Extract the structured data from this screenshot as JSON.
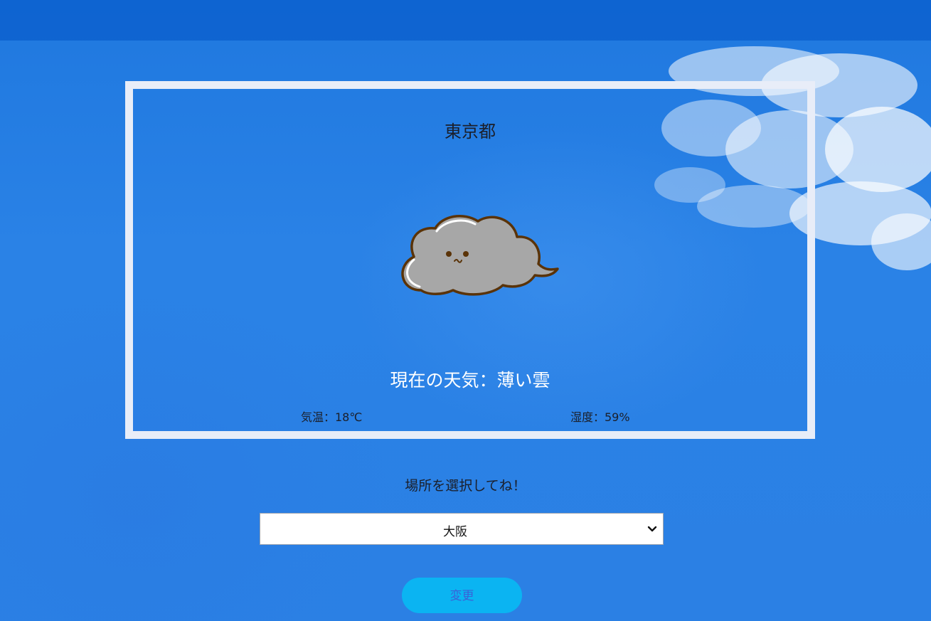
{
  "weather": {
    "city": "東京都",
    "description": "現在の天気：薄い雲",
    "temperature": "気温：18℃",
    "humidity": "湿度：59%",
    "icon": "cloud-character-icon"
  },
  "location_picker": {
    "label": "場所を選択してね！",
    "selected": "大阪",
    "button_label": "変更"
  },
  "colors": {
    "sky": "#2a7fe3",
    "card_border": "#e8edf8",
    "button": "#0bb4f2",
    "button_text": "#3a62d8",
    "cloud_fill": "#a7a7a7",
    "cloud_outline": "#5a3308"
  }
}
